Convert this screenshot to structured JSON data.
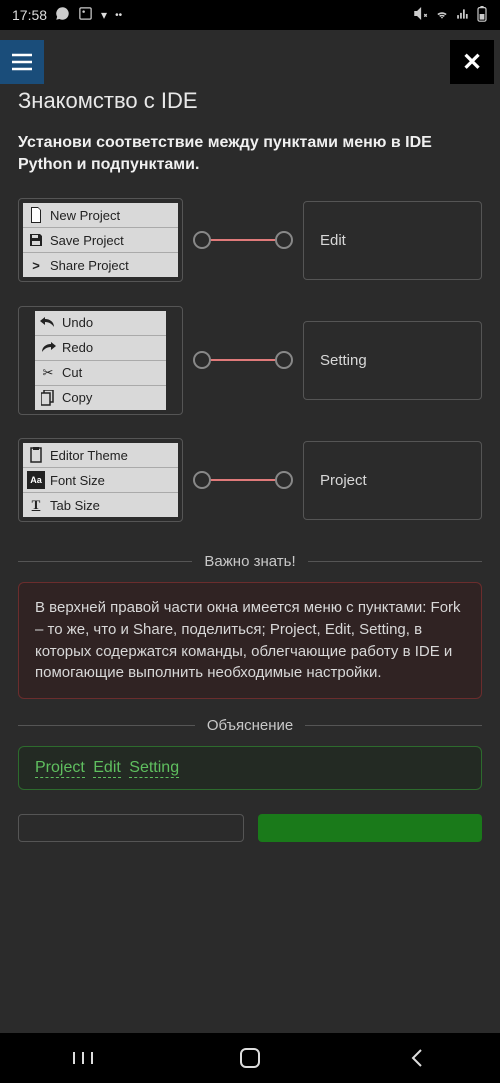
{
  "status": {
    "time": "17:58",
    "icons_left": [
      "whatsapp",
      "image",
      "down-arrow",
      "dots"
    ]
  },
  "page_title": "Знакомство с IDE",
  "instruction": "Установи соответствие между пунктами меню в IDE Python и подпунктами.",
  "match": {
    "rows": [
      {
        "left_items": [
          {
            "icon": "file-icon",
            "label": "New Project"
          },
          {
            "icon": "save-icon",
            "label": "Save Project"
          },
          {
            "icon": "share-icon",
            "label": "Share Project"
          }
        ],
        "right_label": "Edit"
      },
      {
        "left_items": [
          {
            "icon": "undo-icon",
            "label": "Undo"
          },
          {
            "icon": "redo-icon",
            "label": "Redo"
          },
          {
            "icon": "cut-icon",
            "label": "Cut"
          },
          {
            "icon": "copy-icon",
            "label": "Copy"
          }
        ],
        "right_label": "Setting"
      },
      {
        "left_items": [
          {
            "icon": "clipboard-icon",
            "label": "Editor Theme"
          },
          {
            "icon": "font-icon",
            "label": "Font Size"
          },
          {
            "icon": "text-icon",
            "label": "Tab Size"
          }
        ],
        "right_label": "Project"
      }
    ]
  },
  "sections": {
    "important_label": "Важно знать!",
    "important_text": "В верхней правой части окна имеется меню с пунктами: Fork – то же, что и Share, поделиться; Project, Edit, Setting, в которых содержатся команды, облегчающие работу в IDE и помогающие выполнить необходимые настройки.",
    "explanation_label": "Объяснение",
    "explanation_words": [
      "Project",
      "Edit",
      "Setting"
    ]
  }
}
